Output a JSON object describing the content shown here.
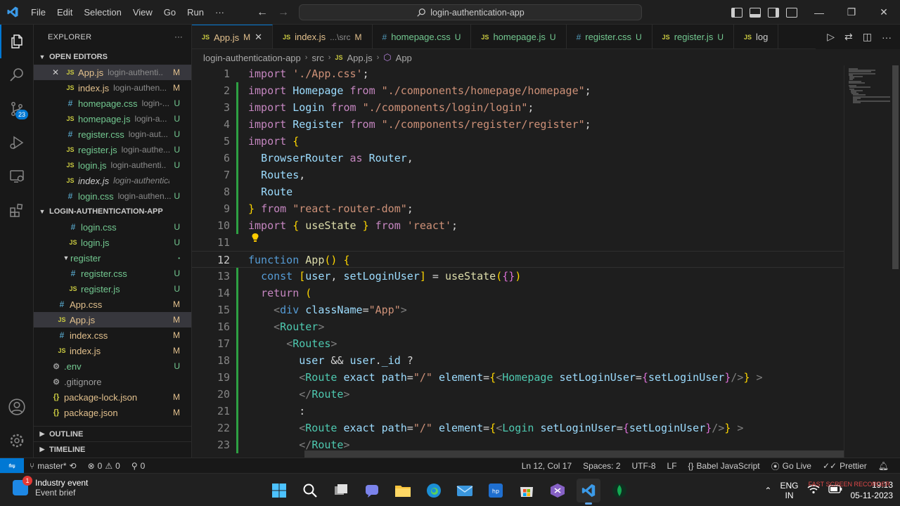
{
  "titlebar": {
    "menu": [
      "File",
      "Edit",
      "Selection",
      "View",
      "Go",
      "Run",
      "···"
    ],
    "search": "login-authentication-app"
  },
  "activity": {
    "scm_badge": "23"
  },
  "explorer": {
    "title": "EXPLORER",
    "more": "···",
    "open_editors": {
      "title": "OPEN EDITORS",
      "items": [
        {
          "icon": "js",
          "name": "App.js",
          "hint": "login-authenti...",
          "status": "M",
          "selected": true,
          "italic": false
        },
        {
          "icon": "js",
          "name": "index.js",
          "hint": "login-authen...",
          "status": "M",
          "selected": false,
          "italic": false
        },
        {
          "icon": "css",
          "name": "homepage.css",
          "hint": "login-...",
          "status": "U",
          "selected": false,
          "italic": false
        },
        {
          "icon": "js",
          "name": "homepage.js",
          "hint": "login-a...",
          "status": "U",
          "selected": false,
          "italic": false
        },
        {
          "icon": "css",
          "name": "register.css",
          "hint": "login-aut...",
          "status": "U",
          "selected": false,
          "italic": false
        },
        {
          "icon": "js",
          "name": "register.js",
          "hint": "login-authe...",
          "status": "U",
          "selected": false,
          "italic": false
        },
        {
          "icon": "js",
          "name": "login.js",
          "hint": "login-authenti...",
          "status": "U",
          "selected": false,
          "italic": false
        },
        {
          "icon": "js",
          "name": "index.js",
          "hint": "login-authentication...",
          "status": "",
          "selected": false,
          "italic": true
        },
        {
          "icon": "css",
          "name": "login.css",
          "hint": "login-authen...",
          "status": "U",
          "selected": false,
          "italic": false
        }
      ]
    },
    "project": {
      "title": "LOGIN-AUTHENTICATION-APP",
      "items": [
        {
          "icon": "css",
          "name": "login.css",
          "status": "U",
          "indent": 48,
          "kind": "file"
        },
        {
          "icon": "js",
          "name": "login.js",
          "status": "U",
          "indent": 48,
          "kind": "file"
        },
        {
          "icon": "",
          "name": "register",
          "status": "•",
          "indent": 40,
          "kind": "folder"
        },
        {
          "icon": "css",
          "name": "register.css",
          "status": "U",
          "indent": 48,
          "kind": "file"
        },
        {
          "icon": "js",
          "name": "register.js",
          "status": "U",
          "indent": 48,
          "kind": "file"
        },
        {
          "icon": "css",
          "name": "App.css",
          "status": "M",
          "indent": 32,
          "kind": "file"
        },
        {
          "icon": "js",
          "name": "App.js",
          "status": "M",
          "indent": 32,
          "kind": "file",
          "selected": true
        },
        {
          "icon": "css",
          "name": "index.css",
          "status": "M",
          "indent": 32,
          "kind": "file"
        },
        {
          "icon": "js",
          "name": "index.js",
          "status": "M",
          "indent": 32,
          "kind": "file"
        },
        {
          "icon": "env",
          "name": ".env",
          "status": "U",
          "indent": 24,
          "kind": "file"
        },
        {
          "icon": "env",
          "name": ".gitignore",
          "status": "",
          "indent": 24,
          "kind": "file"
        },
        {
          "icon": "json",
          "name": "package-lock.json",
          "status": "M",
          "indent": 24,
          "kind": "file"
        },
        {
          "icon": "json",
          "name": "package.json",
          "status": "M",
          "indent": 24,
          "kind": "file"
        }
      ]
    },
    "outline": "OUTLINE",
    "timeline": "TIMELINE"
  },
  "tabs": [
    {
      "icon": "js",
      "label": "App.js",
      "path": "",
      "status": "M",
      "active": true,
      "close": "✕"
    },
    {
      "icon": "js",
      "label": "index.js",
      "path": "...\\src",
      "status": "M",
      "active": false,
      "close": ""
    },
    {
      "icon": "css",
      "label": "homepage.css",
      "path": "",
      "status": "U",
      "active": false,
      "close": ""
    },
    {
      "icon": "js",
      "label": "homepage.js",
      "path": "",
      "status": "U",
      "active": false,
      "close": ""
    },
    {
      "icon": "css",
      "label": "register.css",
      "path": "",
      "status": "U",
      "active": false,
      "close": ""
    },
    {
      "icon": "js",
      "label": "register.js",
      "path": "",
      "status": "U",
      "active": false,
      "close": ""
    },
    {
      "icon": "js",
      "label": "log",
      "path": "",
      "status": "",
      "active": false,
      "close": ""
    }
  ],
  "breadcrumb": [
    "login-authentication-app",
    "src",
    "App.js",
    "App"
  ],
  "editor": {
    "current_line": 12,
    "lines": [
      {
        "n": "1",
        "text": "import './App.css';"
      },
      {
        "n": "2",
        "text": "import Homepage from \"./components/homepage/homepage\";"
      },
      {
        "n": "3",
        "text": "import Login from \"./components/login/login\";"
      },
      {
        "n": "4",
        "text": "import Register from \"./components/register/register\";"
      },
      {
        "n": "5",
        "text": "import {"
      },
      {
        "n": "6",
        "text": "  BrowserRouter as Router,"
      },
      {
        "n": "7",
        "text": "  Routes,"
      },
      {
        "n": "8",
        "text": "  Route"
      },
      {
        "n": "9",
        "text": "} from \"react-router-dom\";"
      },
      {
        "n": "10",
        "text": "import { useState } from 'react';"
      },
      {
        "n": "11",
        "text": ""
      },
      {
        "n": "12",
        "text": "function App() {"
      },
      {
        "n": "13",
        "text": "  const [user, setLoginUser] = useState({})"
      },
      {
        "n": "14",
        "text": "  return ("
      },
      {
        "n": "15",
        "text": "    <div className=\"App\">"
      },
      {
        "n": "16",
        "text": "    <Router>"
      },
      {
        "n": "17",
        "text": "      <Routes>"
      },
      {
        "n": "18",
        "text": "        user && user._id ?"
      },
      {
        "n": "19",
        "text": "        <Route exact path=\"/\" element={<Homepage setLoginUser={setLoginUser}/>} >"
      },
      {
        "n": "20",
        "text": "        </Route>"
      },
      {
        "n": "21",
        "text": "        :"
      },
      {
        "n": "22",
        "text": "        <Route exact path=\"/\" element={<Login setLoginUser={setLoginUser}/>} >"
      },
      {
        "n": "23",
        "text": "        </Route>"
      }
    ]
  },
  "status": {
    "branch": "master*",
    "errors": "0",
    "warnings": "0",
    "ports": "0",
    "position": "Ln 12, Col 17",
    "spaces": "Spaces: 2",
    "encoding": "UTF-8",
    "eol": "LF",
    "language": "Babel JavaScript",
    "golive": "Go Live",
    "prettier": "Prettier"
  },
  "taskbar": {
    "widget_title": "Industry event",
    "widget_sub": "Event brief",
    "widget_badge": "1",
    "lang1": "ENG",
    "lang2": "IN",
    "time": "19:13",
    "date": "05-11-2023",
    "watermark": "FAST SCREEN RECORDER"
  },
  "colors": {
    "accent": "#0078d4",
    "modified": "#e2c08d",
    "untracked": "#73c991"
  }
}
